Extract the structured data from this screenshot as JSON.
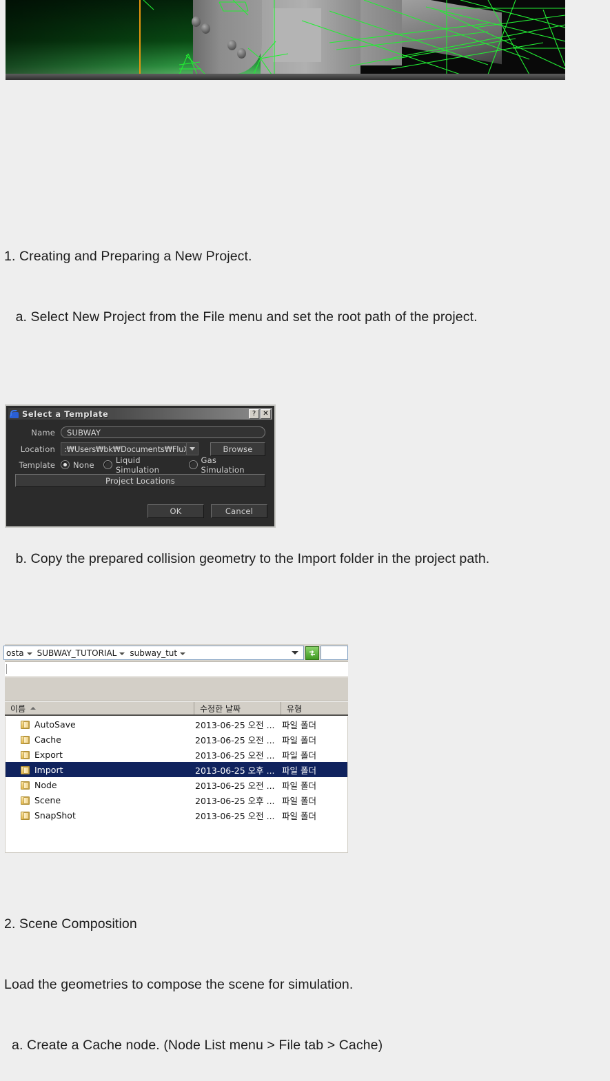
{
  "document": {
    "sections": [
      {
        "id": "s1",
        "text": "1. Creating and Preparing a New Project."
      },
      {
        "id": "s1a",
        "text": "   a. Select New Project from the File menu and set the root path of the project."
      },
      {
        "id": "s1b",
        "text": "   b. Copy the prepared collision geometry to the Import folder in the project path."
      },
      {
        "id": "s2",
        "text": "2. Scene Composition"
      },
      {
        "id": "s2_intro",
        "text": "Load the geometries to compose the scene for simulation."
      },
      {
        "id": "s2a",
        "text": "  a. Create a Cache node. (Node List menu > File tab > Cache)"
      }
    ]
  },
  "viewport": {
    "alt": "3D simulation viewport with green gradient background, grey geometry and green wireframe overlay",
    "background_color": "#0b3d12",
    "wire_color": "#22ee33",
    "axis_color": "#e8960f"
  },
  "template_dialog": {
    "title": "Select a Template",
    "icon": "flux-app-icon",
    "help_button": "?",
    "close_button": "✕",
    "name_label": "Name",
    "name_value": "SUBWAY",
    "location_label": "Location",
    "location_value": ":₩Users₩bk₩Documents₩FluX",
    "browse_label": "Browse",
    "template_label": "Template",
    "template_options": [
      {
        "label": "None",
        "selected": true
      },
      {
        "label": "Liquid Simulation",
        "selected": false
      },
      {
        "label": "Gas Simulation",
        "selected": false
      }
    ],
    "project_locations_label": "Project Locations",
    "ok_label": "OK",
    "cancel_label": "Cancel"
  },
  "explorer": {
    "breadcrumbs": [
      "osta",
      "SUBWAY_TUTORIAL",
      "subway_tut"
    ],
    "refresh_icon": "refresh-icon",
    "columns": [
      {
        "key": "name",
        "label": "이름",
        "sorted": "asc"
      },
      {
        "key": "date",
        "label": "수정한 날짜"
      },
      {
        "key": "type",
        "label": "유형"
      }
    ],
    "rows": [
      {
        "name": "AutoSave",
        "date": "2013-06-25 오전 ...",
        "type": "파일 폴더",
        "selected": false
      },
      {
        "name": "Cache",
        "date": "2013-06-25 오전 ...",
        "type": "파일 폴더",
        "selected": false
      },
      {
        "name": "Export",
        "date": "2013-06-25 오전 ...",
        "type": "파일 폴더",
        "selected": false
      },
      {
        "name": "Import",
        "date": "2013-06-25 오후 ...",
        "type": "파일 폴더",
        "selected": true
      },
      {
        "name": "Node",
        "date": "2013-06-25 오전 ...",
        "type": "파일 폴더",
        "selected": false
      },
      {
        "name": "Scene",
        "date": "2013-06-25 오후 ...",
        "type": "파일 폴더",
        "selected": false
      },
      {
        "name": "SnapShot",
        "date": "2013-06-25 오전 ...",
        "type": "파일 폴더",
        "selected": false
      }
    ],
    "selection_color": "#10235e"
  }
}
